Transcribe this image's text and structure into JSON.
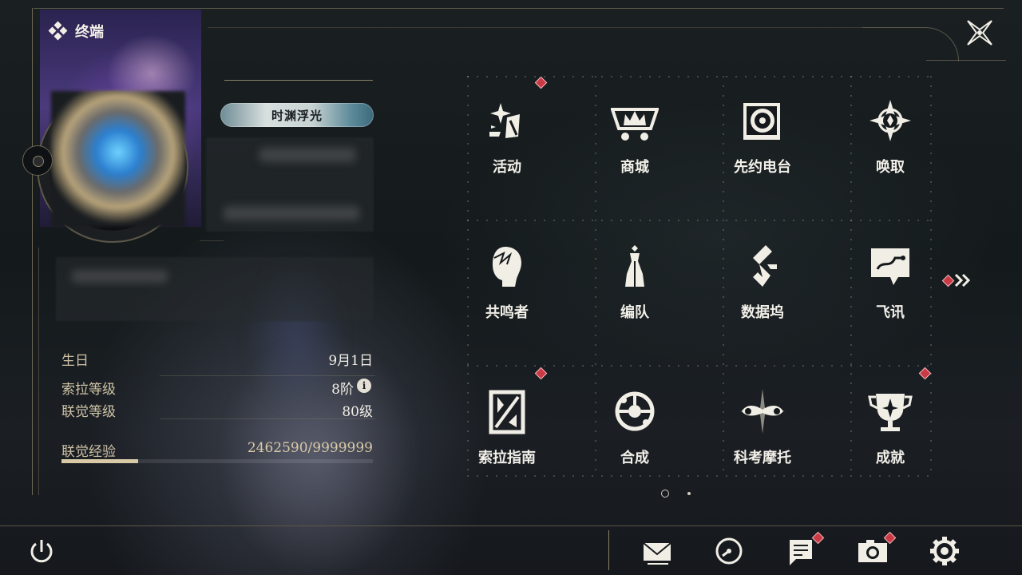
{
  "header": {
    "title": "终端"
  },
  "profile": {
    "title_badge": "时渊浮光",
    "stats": [
      {
        "label": "生日",
        "value": "9月1日"
      },
      {
        "label": "索拉等级",
        "value": "8阶"
      },
      {
        "label": "联觉等级",
        "value": "80级"
      }
    ],
    "exp": {
      "label": "联觉经验",
      "value": "2462590/9999999",
      "fraction": 0.246
    }
  },
  "menu": [
    {
      "label": "活动",
      "icon": "event-sparkle-icon",
      "badge": true
    },
    {
      "label": "商城",
      "icon": "shop-crown-cart-icon",
      "badge": false
    },
    {
      "label": "先约电台",
      "icon": "radio-vinyl-icon",
      "badge": false
    },
    {
      "label": "唤取",
      "icon": "gacha-compass-icon",
      "badge": false
    },
    {
      "label": "共鸣者",
      "icon": "resonator-head-icon",
      "badge": false
    },
    {
      "label": "编队",
      "icon": "team-chess-icon",
      "badge": false
    },
    {
      "label": "数据坞",
      "icon": "data-dock-icon",
      "badge": false
    },
    {
      "label": "飞讯",
      "icon": "chat-bubble-icon",
      "badge": false
    },
    {
      "label": "索拉指南",
      "icon": "guide-book-icon",
      "badge": true
    },
    {
      "label": "合成",
      "icon": "synthesis-orb-icon",
      "badge": false
    },
    {
      "label": "科考摩托",
      "icon": "motorbike-star-icon",
      "badge": false
    },
    {
      "label": "成就",
      "icon": "achievement-trophy-icon",
      "badge": true
    }
  ],
  "pagination": {
    "current": 1,
    "total": 2
  },
  "bottom_bar": [
    {
      "icon": "mail-icon",
      "badge": false
    },
    {
      "icon": "clock-icon",
      "badge": false
    },
    {
      "icon": "notice-icon",
      "badge": true
    },
    {
      "icon": "camera-icon",
      "badge": true
    },
    {
      "icon": "settings-gear-icon",
      "badge": false
    }
  ],
  "colors": {
    "accent": "#d9c9a6",
    "badge": "#c93a45",
    "text": "#f2efe8"
  }
}
